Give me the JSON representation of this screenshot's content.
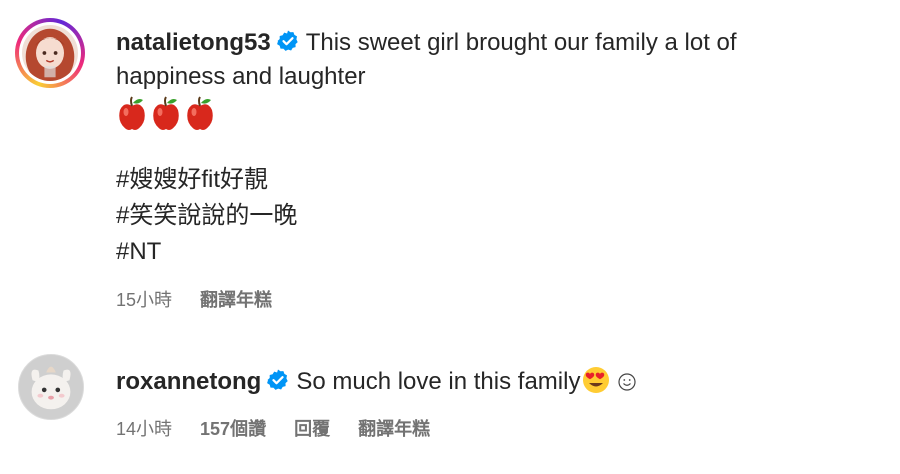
{
  "comments": [
    {
      "username": "natalietong53",
      "verified": true,
      "text_line1": "This sweet girl brought our family a lot of",
      "text_line2": "happiness and laughter",
      "emojis": [
        "apple",
        "apple",
        "apple"
      ],
      "hashtags": [
        "#嫂嫂好fit好靚",
        "#笑笑說說的一晚",
        "#NT"
      ],
      "time": "15小時",
      "translate": "翻譯年糕"
    },
    {
      "username": "roxannetong",
      "verified": true,
      "text": "So much love in this family",
      "emojis": [
        "heart-eyes-face",
        "smiling-face"
      ],
      "time": "14小時",
      "likes": "157個讚",
      "reply": "回覆",
      "translate": "翻譯年糕"
    }
  ],
  "colors": {
    "verified_blue": "#0095f6",
    "text": "#262626",
    "meta": "#737373"
  }
}
